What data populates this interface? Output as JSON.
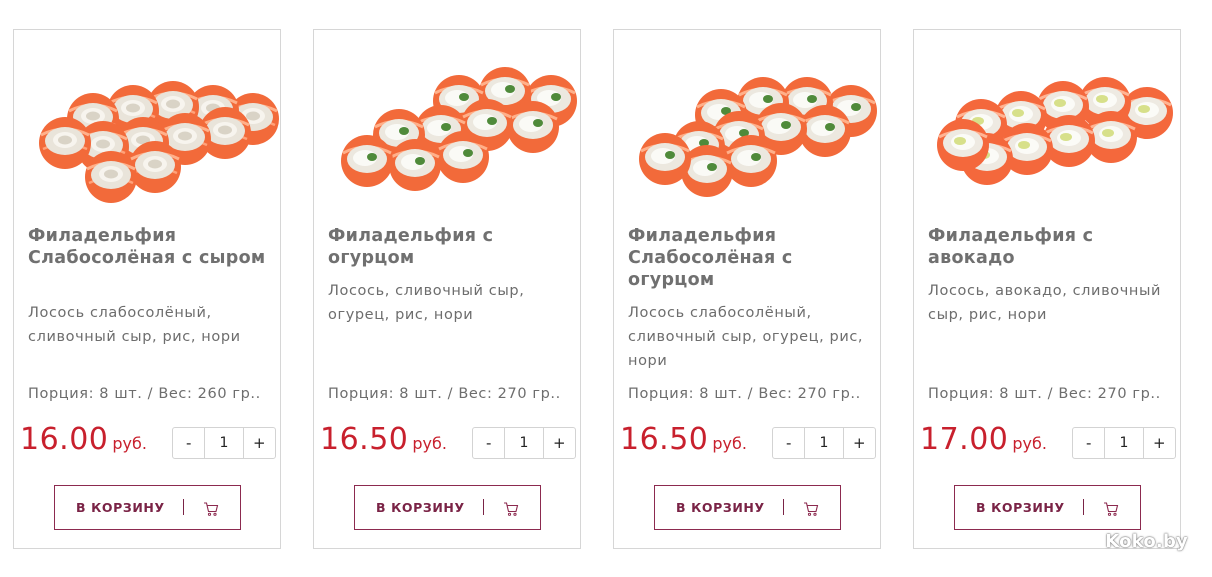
{
  "colors": {
    "price": "#c8202d",
    "button_border": "#8c2a4f",
    "button_text": "#7a2346"
  },
  "currency": "руб.",
  "cart_button_label": "В КОРЗИНУ",
  "cart_icon": "shopping-cart-icon",
  "minus_label": "-",
  "plus_label": "+",
  "watermark": "Koko.by",
  "products": [
    {
      "name": "Филадельфия Слабосолёная с сыром",
      "description": "Лосось слабосолёный, сливочный сыр, рис, нори",
      "portion": "Порция: 8 шт. / Вес: 260 гр..",
      "price": "16.00",
      "quantity": "1"
    },
    {
      "name": "Филадельфия с огурцом",
      "description": "Лосось, сливочный сыр, огурец, рис, нори",
      "portion": "Порция: 8 шт. / Вес: 270 гр..",
      "price": "16.50",
      "quantity": "1"
    },
    {
      "name": "Филадельфия Слабосолёная с огурцом",
      "description": "Лосось слабосолёный, сливочный сыр, огурец, рис, нори",
      "portion": "Порция: 8 шт. / Вес: 270 гр..",
      "price": "16.50",
      "quantity": "1"
    },
    {
      "name": "Филадельфия с авокадо",
      "description": "Лосось, авокадо, сливочный сыр, рис, нори",
      "portion": "Порция: 8 шт. / Вес: 270 гр..",
      "price": "17.00",
      "quantity": "1"
    }
  ]
}
